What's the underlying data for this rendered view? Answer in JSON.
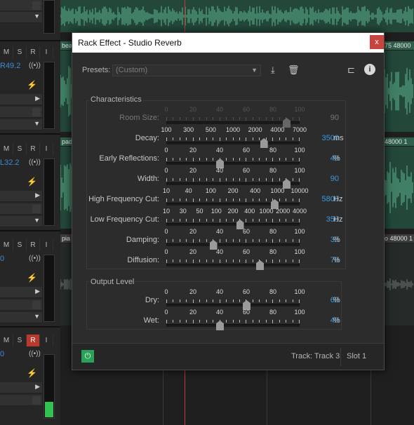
{
  "dialog": {
    "title": "Rack Effect - Studio Reverb",
    "close": "x",
    "presets_label": "Presets:",
    "presets_value": "(Custom)",
    "characteristics_title": "Characteristics",
    "output_title": "Output Level",
    "track": "Track: Track 3",
    "slot": "Slot 1",
    "icons": [
      "save-preset-icon",
      "delete-preset-icon",
      "routing-icon",
      "info-icon",
      "power-icon"
    ]
  },
  "params": [
    {
      "label": "Room Size:",
      "ticks": [
        "0",
        "20",
        "40",
        "60",
        "80",
        "100"
      ],
      "value": "90",
      "unit": "",
      "fraction": 0.9,
      "disabled": true
    },
    {
      "label": "Decay:",
      "ticks": [
        "100",
        "300",
        "500",
        "1000",
        "2000",
        "4000",
        "7000"
      ],
      "value": "3500",
      "unit": "ms",
      "fraction": 0.73,
      "disabled": false
    },
    {
      "label": "Early Reflections:",
      "ticks": [
        "0",
        "20",
        "40",
        "60",
        "80",
        "100"
      ],
      "value": "40",
      "unit": "%",
      "fraction": 0.4,
      "disabled": false
    },
    {
      "label": "Width:",
      "ticks": [
        "0",
        "20",
        "40",
        "60",
        "80",
        "100"
      ],
      "value": "90",
      "unit": "",
      "fraction": 0.9,
      "disabled": false
    },
    {
      "label": "High Frequency Cut:",
      "ticks": [
        "10",
        "40",
        "100",
        "200",
        "400",
        "1000",
        "10000"
      ],
      "value": "5800",
      "unit": "Hz",
      "fraction": 0.81,
      "disabled": false
    },
    {
      "label": "Low Frequency Cut:",
      "ticks": [
        "10",
        "30",
        "50",
        "100",
        "200",
        "400",
        "1000",
        "2000",
        "4000"
      ],
      "value": "350",
      "unit": "Hz",
      "fraction": 0.55,
      "disabled": false
    },
    {
      "label": "Damping:",
      "ticks": [
        "0",
        "20",
        "40",
        "60",
        "80",
        "100"
      ],
      "value": "35",
      "unit": "%",
      "fraction": 0.35,
      "disabled": false
    },
    {
      "label": "Diffusion:",
      "ticks": [
        "0",
        "20",
        "40",
        "60",
        "80",
        "100"
      ],
      "value": "70",
      "unit": "%",
      "fraction": 0.7,
      "disabled": false
    }
  ],
  "output": [
    {
      "label": "Dry:",
      "ticks": [
        "0",
        "20",
        "40",
        "60",
        "80",
        "100"
      ],
      "value": "60",
      "unit": "%",
      "fraction": 0.6,
      "disabled": false
    },
    {
      "label": "Wet:",
      "ticks": [
        "0",
        "20",
        "40",
        "60",
        "80",
        "100"
      ],
      "value": "40",
      "unit": "%",
      "fraction": 0.4,
      "disabled": false
    }
  ],
  "tracks": [
    {
      "pan": "",
      "rec_on": false
    },
    {
      "pan": "R49.2",
      "rec_on": false
    },
    {
      "pan": "L32.2",
      "rec_on": false
    },
    {
      "pan": "0",
      "rec_on": false
    },
    {
      "pan": "0",
      "rec_on": true
    }
  ],
  "track_buttons": [
    "M",
    "S",
    "R",
    "I"
  ],
  "clips": [
    {
      "name": "bea",
      "info": "75 48000"
    },
    {
      "name": "pad",
      "info": "48000 1"
    },
    {
      "name": "pia",
      "info": "o 48000 1"
    }
  ],
  "colors": {
    "accent_value": "#3b9ae0",
    "record": "#b83a2e",
    "power": "#2aa05a",
    "close": "#c8453f",
    "meter": "#31c251"
  }
}
